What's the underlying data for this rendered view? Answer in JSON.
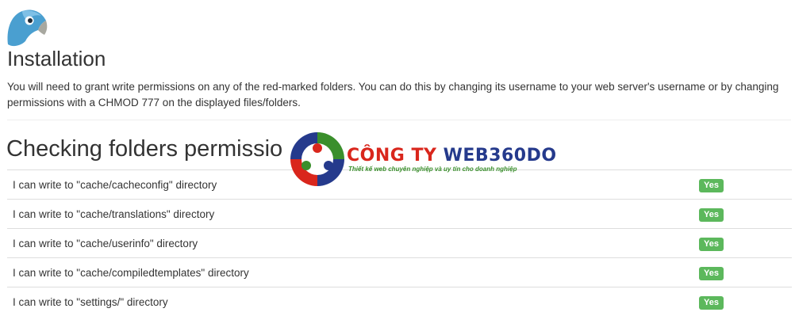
{
  "header": {
    "logo_icon": "bird-logo-icon",
    "title": "Installation",
    "intro": "You will need to grant write permissions on any of the red-marked folders. You can do this by changing its username to your web server's username or by changing permissions with a CHMOD 777 on the displayed files/folders."
  },
  "checks": {
    "title": "Checking folders permissio",
    "rows": [
      {
        "label": "I can write to \"cache/cacheconfig\" directory",
        "status": "Yes"
      },
      {
        "label": "I can write to \"cache/translations\" directory",
        "status": "Yes"
      },
      {
        "label": "I can write to \"cache/userinfo\" directory",
        "status": "Yes"
      },
      {
        "label": "I can write to \"cache/compiledtemplates\" directory",
        "status": "Yes"
      },
      {
        "label": "I can write to \"settings/\" directory",
        "status": "Yes"
      }
    ]
  },
  "watermark": {
    "brand_part1": "CÔNG TY ",
    "brand_part2": "WEB360DO",
    "tagline": "Thiết kế web chuyên nghiệp và uy tín cho doanh nghiệp",
    "mark_icon": "web360do-logo-icon"
  },
  "colors": {
    "success": "#5cb85c",
    "brand_red": "#d9261c",
    "brand_blue": "#253a8c",
    "brand_green": "#3a8f2c"
  }
}
